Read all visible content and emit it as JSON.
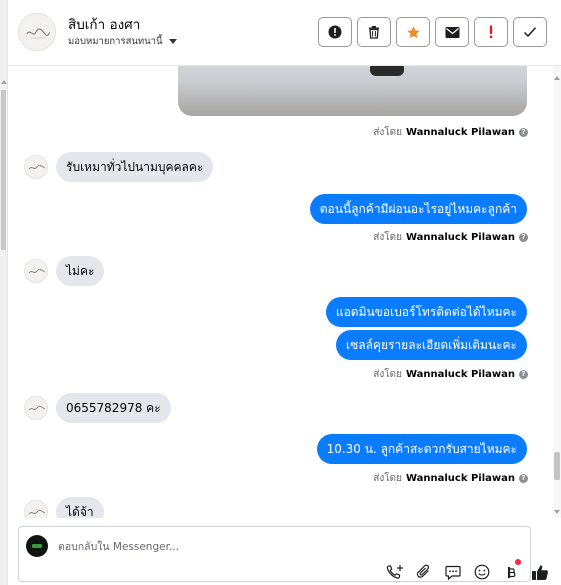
{
  "header": {
    "name": "สิบเก้า องศา",
    "assign_label": "มอบหมายการสนทนานี้"
  },
  "actions": [
    {
      "name": "mark-spam-button",
      "icon": "alert-circle-icon"
    },
    {
      "name": "delete-button",
      "icon": "trash-icon"
    },
    {
      "name": "star-button",
      "icon": "star-icon",
      "color": "#f08a24"
    },
    {
      "name": "mark-unread-button",
      "icon": "envelope-icon"
    },
    {
      "name": "follow-up-button",
      "icon": "exclamation-icon",
      "color": "#e02020"
    },
    {
      "name": "mark-done-button",
      "icon": "checkmark-icon"
    }
  ],
  "messages": [
    {
      "dir": "out",
      "type": "image",
      "sent_by_prefix": "ส่งโดย",
      "sent_by_name": "Wannaluck Pilawan"
    },
    {
      "dir": "in",
      "text": "รับเหมาทั่วไปนามบุคคลคะ"
    },
    {
      "dir": "out",
      "text": "ตอนนี้ลูกค้ามีผ่อนอะไรอยู่ไหมคะลูกค้า",
      "sent_by_prefix": "ส่งโดย",
      "sent_by_name": "Wannaluck Pilawan"
    },
    {
      "dir": "in",
      "text": "ไม่คะ"
    },
    {
      "dir": "out",
      "text": "แอดมินขอเบอร์โทรติดต่อได้ไหมคะ"
    },
    {
      "dir": "out",
      "text": "เซลล์คุยรายละเอียดเพิ่มเติมนะคะ",
      "sent_by_prefix": "ส่งโดย",
      "sent_by_name": "Wannaluck Pilawan"
    },
    {
      "dir": "in",
      "text": "0655782978 คะ"
    },
    {
      "dir": "out",
      "text": "10.30  น.  ลูกค้าสะดวกรับสายไหมคะ",
      "sent_by_prefix": "ส่งโดย",
      "sent_by_name": "Wannaluck Pilawan"
    },
    {
      "dir": "in",
      "text": "ได้จ้า"
    }
  ],
  "composer": {
    "placeholder": "ตอบกลับใน Messenger...",
    "tools": [
      "phone-plus-icon",
      "paperclip-icon",
      "saved-reply-icon",
      "emoji-icon",
      "meta-ai-icon",
      "thumbs-up-icon"
    ]
  },
  "colors": {
    "outgoing_bubble": "#0a7cff",
    "incoming_bubble": "#e4e6eb",
    "notification_dot": "#f02849"
  }
}
